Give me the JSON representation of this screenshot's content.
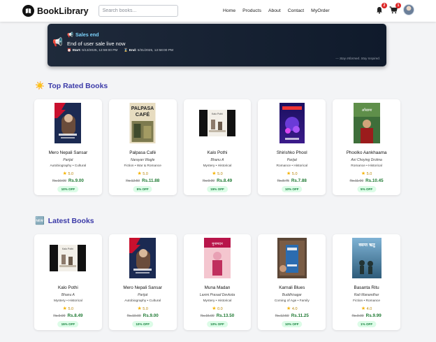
{
  "navbar": {
    "brand": "BookLibrary",
    "search_placeholder": "Search books...",
    "menu": [
      "Home",
      "Products",
      "About",
      "Contact",
      "MyOrder"
    ],
    "notification_count": "2",
    "cart_count": "1"
  },
  "banner": {
    "title": "Sales end",
    "message": "End of user sale live now",
    "start_label": "Start:",
    "start_value": "5/13/2025, 12:59:00 PM",
    "end_label": "End:",
    "end_value": "5/31/2025, 12:58:00 PM",
    "tagline": "— Stay Informed. Stay Inspired."
  },
  "top_rated": {
    "title": "Top Rated Books",
    "books": [
      {
        "title": "Mero Nepali Sansar",
        "author": "Parijat",
        "genre": "Autobiography • Cultural",
        "rating": "5.0",
        "old_price": "Rs.10.00",
        "price": "Rs.9.00",
        "discount": "10% OFF"
      },
      {
        "title": "Palpasa Café",
        "author": "Narayan Wagle",
        "genre": "Fiction • War & Romance",
        "rating": "5.0",
        "old_price": "Rs.12.50",
        "price": "Rs.11.88",
        "discount": "5% OFF"
      },
      {
        "title": "Kalo Pothi",
        "author": "Bhanu A",
        "genre": "Mystery • Historical",
        "rating": "5.0",
        "old_price": "Rs.9.99",
        "price": "Rs.8.49",
        "discount": "15% OFF"
      },
      {
        "title": "Shirishko Phool",
        "author": "Parijat",
        "genre": "Romance • Historical",
        "rating": "5.0",
        "old_price": "Rs.8.75",
        "price": "Rs.7.88",
        "discount": "10% OFF"
      },
      {
        "title": "Phoolko Aankhaama",
        "author": "Ani Choying Drolma",
        "genre": "Romance • Historical",
        "rating": "5.0",
        "old_price": "Rs.11.00",
        "price": "Rs.10.45",
        "discount": "5% OFF"
      }
    ]
  },
  "latest": {
    "title": "Latest Books",
    "books": [
      {
        "title": "Kalo Pothi",
        "author": "Bhanu A",
        "genre": "Mystery • Historical",
        "rating": "5.0",
        "old_price": "Rs.9.99",
        "price": "Rs.8.49",
        "discount": "15% OFF"
      },
      {
        "title": "Mero Nepali Sansar",
        "author": "Parijat",
        "genre": "Autobiography • Cultural",
        "rating": "5.0",
        "old_price": "Rs.10.00",
        "price": "Rs.9.00",
        "discount": "10% OFF"
      },
      {
        "title": "Muna Madan",
        "author": "Laxmi Prasad Devkota",
        "genre": "Mystery • Historical",
        "rating": "0.0",
        "old_price": "Rs.15.00",
        "price": "Rs.13.50",
        "discount": "10% OFF"
      },
      {
        "title": "Karnali Blues",
        "author": "Buddhisagar",
        "genre": "Coming of Age • Family",
        "rating": "4.0",
        "old_price": "Rs.12.50",
        "price": "Rs.11.25",
        "discount": "10% OFF"
      },
      {
        "title": "Basanta Ritu",
        "author": "Rati Manandhar",
        "genre": "Fiction • Romance",
        "rating": "4.0",
        "old_price": "Rs.9.99",
        "price": "Rs.9.99",
        "discount": "1% OFF"
      }
    ]
  },
  "colors": {
    "accent": "#3b3aa8",
    "price": "#1f7a33",
    "badge": "#dc2626",
    "banner_title": "#7dd3fc"
  },
  "icons": [
    "book-logo-icon",
    "bell-icon",
    "cart-icon",
    "megaphone-icon",
    "sun-icon",
    "new-icon",
    "star-icon",
    "clock-icon",
    "hourglass-icon"
  ]
}
